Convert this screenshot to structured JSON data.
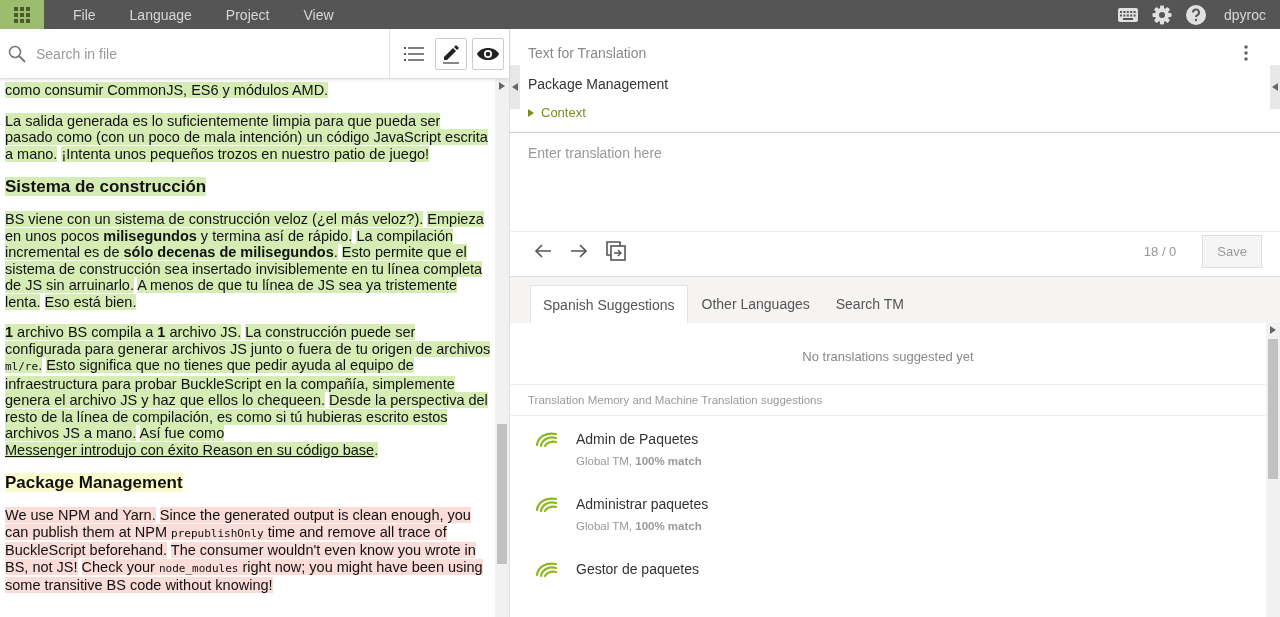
{
  "menu": {
    "items": [
      "File",
      "Language",
      "Project",
      "View"
    ],
    "user": "dpyroc"
  },
  "search": {
    "placeholder": "Search in file"
  },
  "document": {
    "blocks": [
      {
        "kind": "paragraph",
        "translated": true,
        "selected": false,
        "sentences": [
          [
            {
              "kind": "text",
              "text": "como consumir CommonJS, ES6 y módulos AMD."
            }
          ]
        ]
      },
      {
        "kind": "paragraph",
        "translated": true,
        "selected": false,
        "sentences": [
          [
            {
              "kind": "text",
              "text": "La salida generada es lo suficientemente limpia para que pueda ser pasado como (con un poco de mala intención) un código JavaScript escrita a mano."
            }
          ],
          [
            {
              "kind": "text",
              "text": "¡Intenta unos pequeños trozos en nuestro patio de juego!"
            }
          ]
        ]
      },
      {
        "kind": "heading",
        "translated": true,
        "selected": false,
        "sentences": [
          [
            {
              "kind": "text",
              "text": "Sistema de construcción"
            }
          ]
        ]
      },
      {
        "kind": "paragraph",
        "translated": true,
        "selected": false,
        "sentences": [
          [
            {
              "kind": "text",
              "text": "BS viene con un sistema de construcción veloz (¿el más veloz?)."
            }
          ],
          [
            {
              "kind": "text",
              "text": "Empieza en unos pocos **milisegundos** y termina así de rápido."
            }
          ],
          [
            {
              "kind": "text",
              "text": "La compilación incremental es de **sólo decenas de milisegundos**."
            }
          ],
          [
            {
              "kind": "text",
              "text": "Esto permite que el sistema de construcción sea insertado invisiblemente en tu línea completa de JS sin arruinarlo."
            }
          ],
          [
            {
              "kind": "text",
              "text": "A menos de que tu línea de JS sea ya tristemente lenta."
            }
          ],
          [
            {
              "kind": "text",
              "text": "Eso está bien."
            }
          ]
        ]
      },
      {
        "kind": "paragraph",
        "translated": true,
        "selected": false,
        "sentences": [
          [
            {
              "kind": "text",
              "text": "**1** archivo BS compila a **1** archivo JS."
            }
          ],
          [
            {
              "kind": "text",
              "text": "La construcción puede ser configurada para generar archivos JS junto o fuera de tu origen de archivos "
            },
            {
              "kind": "code",
              "text": "ml/re"
            },
            {
              "kind": "text",
              "text": "."
            }
          ],
          [
            {
              "kind": "text",
              "text": "Esto significa que no tienes que pedir ayuda al equipo de infraestructura para probar BuckleScript en la compañía, simplemente genera el archivo JS y haz que ellos lo chequeen."
            }
          ],
          [
            {
              "kind": "text",
              "text": "Desde la perspectiva del resto de la línea de compilación, es como si tú hubieras escrito estos archivos JS a mano."
            }
          ],
          [
            {
              "kind": "text",
              "text": "Así fue como "
            },
            {
              "kind": "link",
              "text": "Messenger introdujo con éxito Reason en su código base"
            },
            {
              "kind": "text",
              "text": "."
            }
          ]
        ]
      },
      {
        "kind": "heading",
        "translated": false,
        "selected": true,
        "sentences": [
          [
            {
              "kind": "text",
              "text": "Package Management"
            }
          ]
        ]
      },
      {
        "kind": "paragraph",
        "translated": false,
        "selected": false,
        "sentences": [
          [
            {
              "kind": "text",
              "text": "We use NPM and Yarn."
            }
          ],
          [
            {
              "kind": "text",
              "text": "Since the generated output is clean enough, you can publish them at NPM "
            },
            {
              "kind": "code",
              "text": "prepublishOnly"
            },
            {
              "kind": "text",
              "text": " time and remove all trace of BuckleScript beforehand."
            }
          ],
          [
            {
              "kind": "text",
              "text": "The consumer wouldn't even know you wrote in BS, not JS!"
            }
          ],
          [
            {
              "kind": "text",
              "text": "Check your "
            },
            {
              "kind": "code",
              "text": "node_modules"
            },
            {
              "kind": "text",
              "text": " right now; you might have been using some transitive BS code without knowing!"
            }
          ]
        ]
      }
    ]
  },
  "source": {
    "header": "Text for Translation",
    "text": "Package Management",
    "context": {
      "label": "Context",
      "expanded": false
    }
  },
  "editor": {
    "placeholder": "Enter translation here",
    "counter": "18 / 0",
    "save": "Save"
  },
  "tabs": [
    {
      "label": "Spanish Suggestions",
      "selected": true
    },
    {
      "label": "Other Languages",
      "selected": false
    },
    {
      "label": "Search TM",
      "selected": false
    }
  ],
  "suggestions": {
    "empty": "No translations suggested yet",
    "section": "Translation Memory and Machine Translation suggestions",
    "items": [
      {
        "text": "Admin de Paquetes",
        "meta": "Global TM, **100% match**"
      },
      {
        "text": "Administrar paquetes",
        "meta": "Global TM, **100% match**"
      },
      {
        "text": "Gestor de paquetes"
      }
    ]
  }
}
